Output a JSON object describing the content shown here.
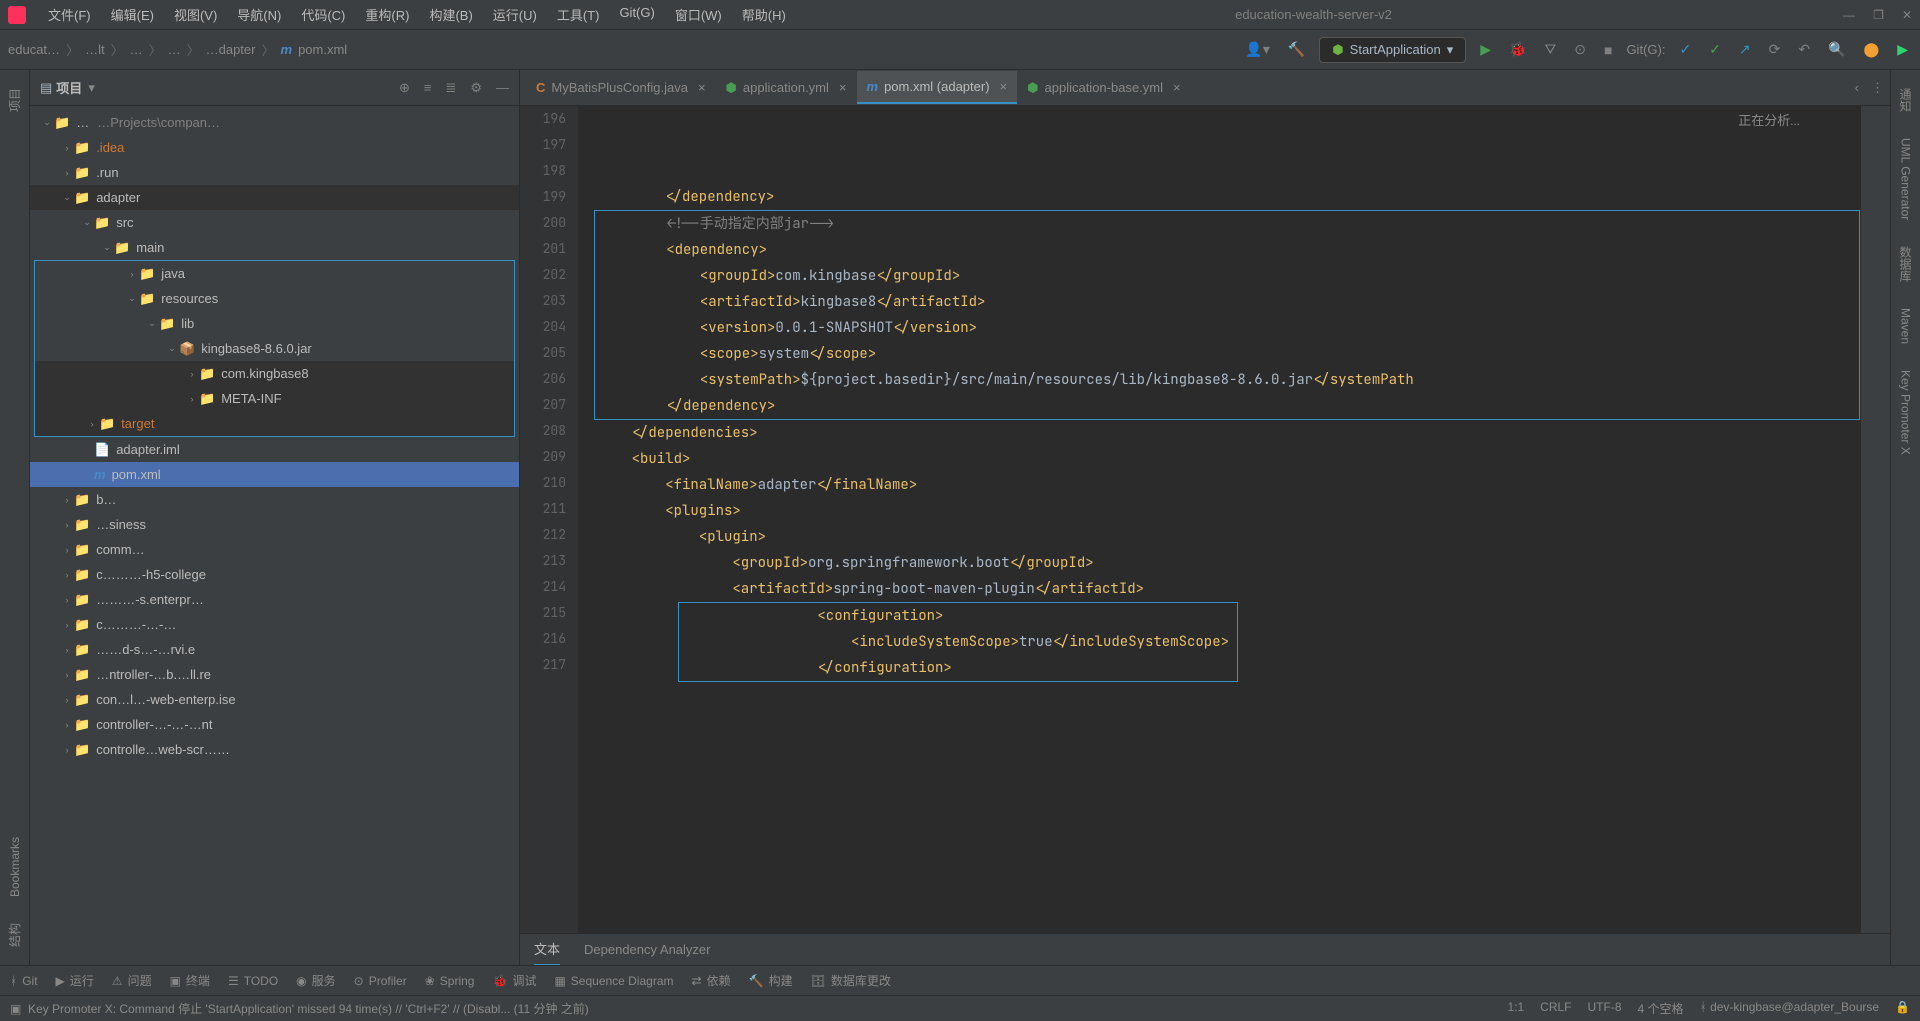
{
  "menubar": {
    "items": [
      "文件(F)",
      "编辑(E)",
      "视图(V)",
      "导航(N)",
      "代码(C)",
      "重构(R)",
      "构建(B)",
      "运行(U)",
      "工具(T)",
      "Git(G)",
      "窗口(W)",
      "帮助(H)"
    ],
    "project_name": "education-wealth-server-v2"
  },
  "breadcrumb": {
    "parts": [
      "educat…",
      "…lt",
      "…",
      "…",
      "…dapter"
    ],
    "file": "pom.xml"
  },
  "run_config": "StartApplication",
  "git_label": "Git(G):",
  "project_panel": {
    "title": "项目",
    "tree": [
      {
        "indent": 0,
        "arrow": "˅",
        "icon": "project",
        "label": "…",
        "path": "…Projects\\compan…"
      },
      {
        "indent": 1,
        "arrow": "›",
        "icon": "folder",
        "label": ".idea",
        "cls": "warn"
      },
      {
        "indent": 1,
        "arrow": "›",
        "icon": "folder",
        "label": ".run"
      },
      {
        "indent": 1,
        "arrow": "˅",
        "icon": "folder",
        "label": "adapter",
        "hl": true
      },
      {
        "indent": 2,
        "arrow": "˅",
        "icon": "folder-src",
        "label": "src"
      },
      {
        "indent": 3,
        "arrow": "˅",
        "icon": "folder",
        "label": "main"
      },
      {
        "indent": 4,
        "arrow": "›",
        "icon": "folder-src",
        "label": "java",
        "boxed": "start"
      },
      {
        "indent": 4,
        "arrow": "˅",
        "icon": "folder-res",
        "label": "resources"
      },
      {
        "indent": 5,
        "arrow": "˅",
        "icon": "folder",
        "label": "lib"
      },
      {
        "indent": 6,
        "arrow": "˅",
        "icon": "jar",
        "label": "kingbase8-8.6.0.jar"
      },
      {
        "indent": 7,
        "arrow": "›",
        "icon": "folder",
        "label": "com.kingbase8",
        "hl": true
      },
      {
        "indent": 7,
        "arrow": "›",
        "icon": "folder",
        "label": "META-INF",
        "hl": true
      },
      {
        "indent": 2,
        "arrow": "›",
        "icon": "folder-ex",
        "label": "target",
        "cls": "warn",
        "hl": true,
        "boxed": "end"
      },
      {
        "indent": 2,
        "arrow": "",
        "icon": "iml",
        "label": "adapter.iml"
      },
      {
        "indent": 2,
        "arrow": "",
        "icon": "m",
        "label": "pom.xml",
        "selected": true
      },
      {
        "indent": 1,
        "arrow": "›",
        "icon": "folder",
        "label": "b…"
      },
      {
        "indent": 1,
        "arrow": "›",
        "icon": "folder",
        "label": "…siness"
      },
      {
        "indent": 1,
        "arrow": "›",
        "icon": "folder",
        "label": "comm…"
      },
      {
        "indent": 1,
        "arrow": "›",
        "icon": "folder",
        "label": "c………-h5-college"
      },
      {
        "indent": 1,
        "arrow": "›",
        "icon": "folder",
        "label": "………-s.enterpr…"
      },
      {
        "indent": 1,
        "arrow": "›",
        "icon": "folder",
        "label": "c………-…-…"
      },
      {
        "indent": 1,
        "arrow": "›",
        "icon": "folder",
        "label": "……d-s…-…rvi.e"
      },
      {
        "indent": 1,
        "arrow": "›",
        "icon": "folder",
        "label": "…ntroller-…b.…ll.re"
      },
      {
        "indent": 1,
        "arrow": "›",
        "icon": "folder",
        "label": "con…l…-web-enterp.ise"
      },
      {
        "indent": 1,
        "arrow": "›",
        "icon": "folder",
        "label": "controller-…-…-…nt"
      },
      {
        "indent": 1,
        "arrow": "›",
        "icon": "folder",
        "label": "controlle…web-scr……"
      }
    ]
  },
  "left_tabs": [
    "项目"
  ],
  "left_tabs_bottom": [
    "Bookmarks",
    "结构"
  ],
  "right_tabs": [
    "通知",
    "UML Generator",
    "数据库",
    "Maven",
    "Key Promoter X"
  ],
  "editor_tabs": [
    {
      "icon": "c",
      "label": "MyBatisPlusConfig.java"
    },
    {
      "icon": "y",
      "label": "application.yml"
    },
    {
      "icon": "m",
      "label": "pom.xml (adapter)",
      "active": true
    },
    {
      "icon": "y",
      "label": "application-base.yml"
    }
  ],
  "analyzing": "正在分析...",
  "code_lines": {
    "start": 196,
    "end": 217,
    "lines": [
      {
        "n": 196,
        "i": 2,
        "xml": "</dependency>"
      },
      {
        "n": 197,
        "i": 0,
        "xml": ""
      },
      {
        "n": 198,
        "i": 2,
        "comment": "<!--手动指定内部jar-->",
        "box_start": true
      },
      {
        "n": 199,
        "i": 2,
        "xml": "<dependency>"
      },
      {
        "n": 200,
        "i": 3,
        "parts": [
          {
            "t": "tag",
            "v": "<groupId>"
          },
          {
            "t": "text",
            "v": "com.kingbase"
          },
          {
            "t": "tag",
            "v": "</groupId>"
          }
        ]
      },
      {
        "n": 201,
        "i": 3,
        "parts": [
          {
            "t": "tag",
            "v": "<artifactId>"
          },
          {
            "t": "text",
            "v": "kingbase8"
          },
          {
            "t": "tag",
            "v": "</artifactId>"
          }
        ]
      },
      {
        "n": 202,
        "i": 3,
        "parts": [
          {
            "t": "tag",
            "v": "<version>"
          },
          {
            "t": "text",
            "v": "0.0.1-SNAPSHOT"
          },
          {
            "t": "tag",
            "v": "</version>"
          }
        ]
      },
      {
        "n": 203,
        "i": 3,
        "parts": [
          {
            "t": "tag",
            "v": "<scope>"
          },
          {
            "t": "text",
            "v": "system"
          },
          {
            "t": "tag",
            "v": "</scope>"
          }
        ]
      },
      {
        "n": 204,
        "i": 3,
        "parts": [
          {
            "t": "tag",
            "v": "<systemPath>"
          },
          {
            "t": "text",
            "v": "${project.basedir}/src/main/resources/lib/kingbase8-8.6.0.jar"
          },
          {
            "t": "tag",
            "v": "</systemPath"
          }
        ]
      },
      {
        "n": 205,
        "i": 2,
        "xml": "</dependency>"
      },
      {
        "n": 206,
        "i": 0,
        "xml": "",
        "box_end": true
      },
      {
        "n": 207,
        "i": 1,
        "xml": "</dependencies>"
      },
      {
        "n": 208,
        "i": 0,
        "xml": ""
      },
      {
        "n": 209,
        "i": 1,
        "xml": "<build>"
      },
      {
        "n": 210,
        "i": 2,
        "parts": [
          {
            "t": "tag",
            "v": "<finalName>"
          },
          {
            "t": "text",
            "v": "adapter"
          },
          {
            "t": "tag",
            "v": "</finalName>"
          }
        ]
      },
      {
        "n": 211,
        "i": 2,
        "xml": "<plugins>"
      },
      {
        "n": 212,
        "i": 3,
        "xml": "<plugin>"
      },
      {
        "n": 213,
        "i": 4,
        "parts": [
          {
            "t": "tag",
            "v": "<groupId>"
          },
          {
            "t": "text",
            "v": "org.springframework.boot"
          },
          {
            "t": "tag",
            "v": "</groupId>"
          }
        ]
      },
      {
        "n": 214,
        "i": 4,
        "parts": [
          {
            "t": "tag",
            "v": "<artifactId>"
          },
          {
            "t": "text",
            "v": "spring-boot-maven-plugin"
          },
          {
            "t": "tag",
            "v": "</artifactId>"
          }
        ]
      },
      {
        "n": 215,
        "i": 4,
        "xml": "<configuration>",
        "box2_start": true
      },
      {
        "n": 216,
        "i": 5,
        "parts": [
          {
            "t": "tag",
            "v": "<includeSystemScope>"
          },
          {
            "t": "text",
            "v": "true"
          },
          {
            "t": "tag",
            "v": "</includeSystemScope>"
          }
        ]
      },
      {
        "n": 217,
        "i": 4,
        "xml": "</configuration>",
        "box2_end": true
      }
    ]
  },
  "editor_bottom_tabs": [
    "文本",
    "Dependency Analyzer"
  ],
  "tool_windows": [
    {
      "icon": "branch",
      "label": "Git"
    },
    {
      "icon": "play",
      "label": "运行"
    },
    {
      "icon": "warn",
      "label": "问题"
    },
    {
      "icon": "term",
      "label": "终端"
    },
    {
      "icon": "todo",
      "label": "TODO"
    },
    {
      "icon": "svc",
      "label": "服务"
    },
    {
      "icon": "prof",
      "label": "Profiler"
    },
    {
      "icon": "spring",
      "label": "Spring"
    },
    {
      "icon": "debug",
      "label": "调试"
    },
    {
      "icon": "seq",
      "label": "Sequence Diagram"
    },
    {
      "icon": "dep",
      "label": "依赖"
    },
    {
      "icon": "build",
      "label": "构建"
    },
    {
      "icon": "db",
      "label": "数据库更改"
    }
  ],
  "status": {
    "left": "Key Promoter X: Command 停止 'StartApplication' missed 94 time(s) // 'Ctrl+F2' // (Disabl... (11 分钟 之前)",
    "pos": "1:1",
    "eol": "CRLF",
    "enc": "UTF-8",
    "indent": "4 个空格",
    "branch": "dev-kingbase@adapter_Bourse",
    "lock": "🔒"
  }
}
